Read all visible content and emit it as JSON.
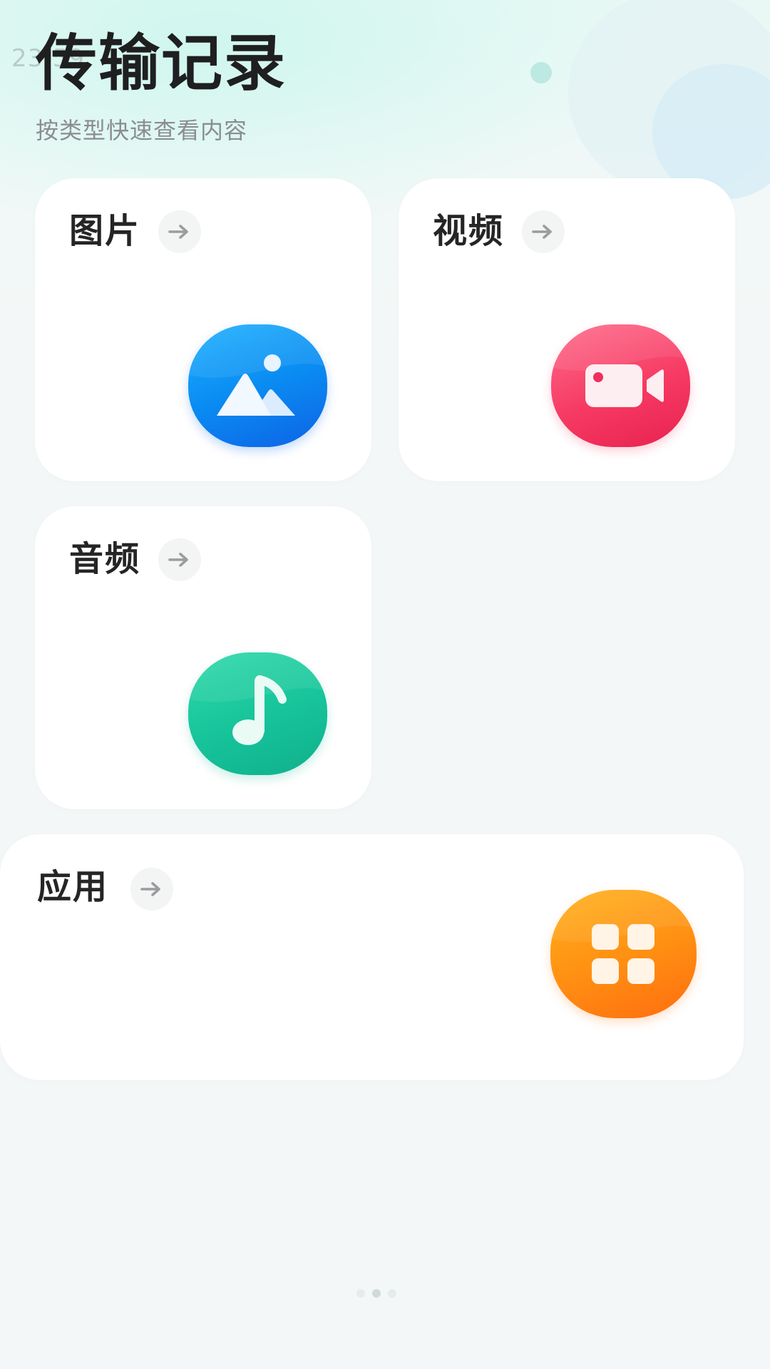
{
  "status": {
    "text": "23:59"
  },
  "header": {
    "title": "传输记录",
    "subtitle": "按类型快速查看内容"
  },
  "categories": [
    {
      "label": "图片",
      "icon": "image-icon",
      "color": "#0a8cf2"
    },
    {
      "label": "视频",
      "icon": "video-camera-icon",
      "color": "#f63a63"
    },
    {
      "label": "音频",
      "icon": "music-note-icon",
      "color": "#16c39a"
    },
    {
      "label": "应用",
      "icon": "apps-grid-icon",
      "color": "#ff8e12"
    }
  ],
  "arrow_icon": "arrow-right-icon",
  "page_indicator": {
    "total": 3,
    "active": 2
  }
}
